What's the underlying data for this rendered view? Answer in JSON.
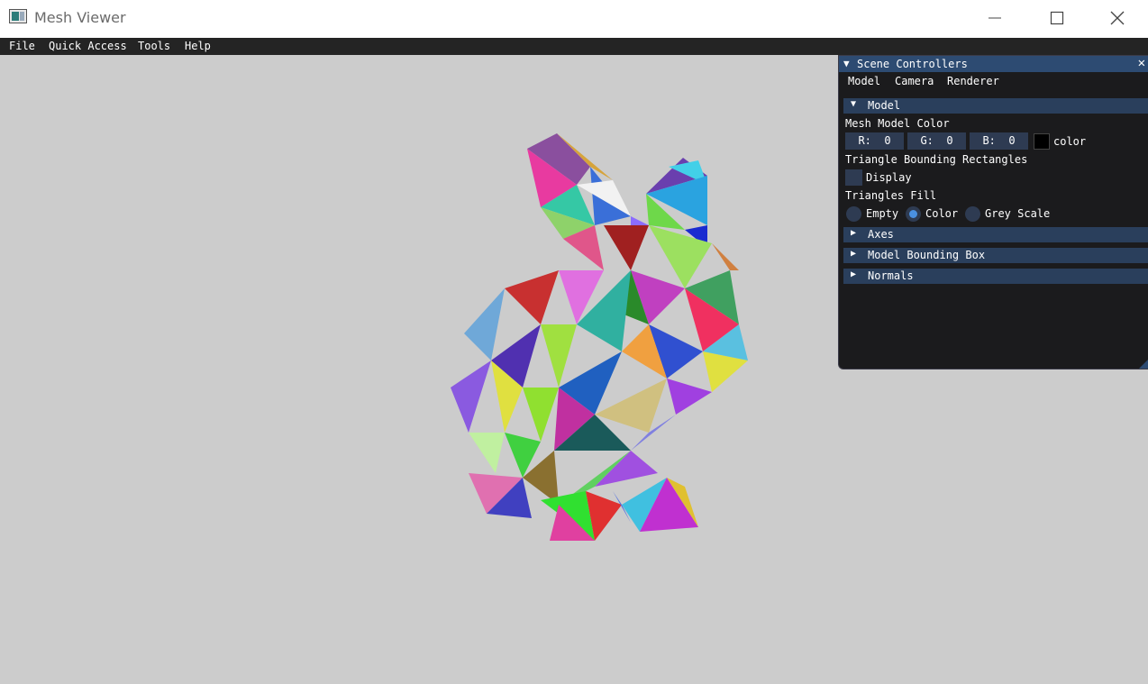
{
  "window": {
    "title": "Mesh Viewer"
  },
  "menu": {
    "items": [
      "File",
      "Quick Access",
      "Tools",
      "Help"
    ]
  },
  "panel": {
    "title": "Scene Controllers",
    "close_glyph": "✕",
    "tabs": [
      "Model",
      "Camera",
      "Renderer"
    ],
    "model_section": {
      "header": "Model",
      "color_label": "Mesh Model Color",
      "r_field": "R:  0",
      "g_field": "G:  0",
      "b_field": "B:  0",
      "color_word": "color",
      "swatch_color": "#000000",
      "bbox_label": "Triangle Bounding Rectangles",
      "display_label": "Display",
      "display_checked": false,
      "fill_label": "Triangles Fill",
      "fill_options": [
        "Empty",
        "Color",
        "Grey Scale"
      ],
      "fill_selected": "Color"
    },
    "collapsed_sections": [
      "Axes",
      "Model Bounding Box",
      "Normals"
    ]
  },
  "colors": {
    "panel_title_bg": "#2d4b72",
    "section_bg": "#2a3f5c",
    "panel_bg": "#1b1b1d",
    "viewport_bg": "#cccccc",
    "radio_selected": "#4a90e0"
  }
}
